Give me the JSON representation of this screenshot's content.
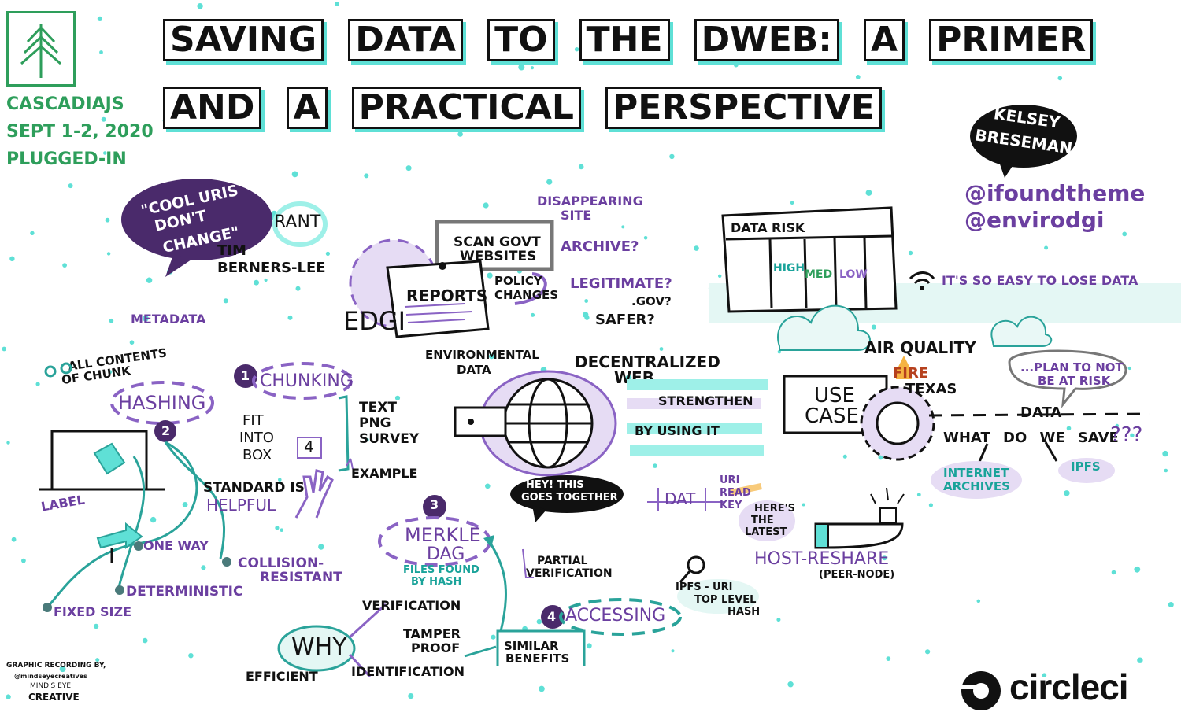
{
  "event": {
    "name": "CASCADIAJS",
    "dates": "SEPT 1-2, 2020",
    "format": "PLUGGED-IN",
    "logo_icon": "pine-tree-icon",
    "color": "#2e9e5b"
  },
  "title": {
    "line1": [
      "SAVING",
      "DATA",
      "TO",
      "THE",
      "DWEB:",
      "A",
      "PRIMER"
    ],
    "line2": [
      "AND",
      "A",
      "PRACTICAL",
      "PERSPECTIVE"
    ]
  },
  "speaker": {
    "name_line1": "KELSEY",
    "name_line2": "BRESEMAN",
    "handle1": "@ifoundtheme",
    "handle2": "@envirodgi"
  },
  "quote": {
    "line1": "\"COOL URIS",
    "line2": "DON'T",
    "line3": "CHANGE\"",
    "author_line1": "TIM",
    "author_line2": "BERNERS-LEE",
    "aside": "RANT"
  },
  "edgi": {
    "name": "EDGI",
    "reports": "REPORTS",
    "scan_line1": "SCAN GOVT",
    "scan_line2": "WEBSITES",
    "disappearing_line1": "DISAPPEARING",
    "disappearing_line2": "SITE",
    "archive": "ARCHIVE?",
    "policy_line1": "POLICY",
    "policy_line2": "CHANGES",
    "legitimate": "LEGITIMATE?",
    "gov": ".GOV?",
    "safer": "SAFER?",
    "env_line1": "ENVIRONMENTAL",
    "env_line2": "DATA"
  },
  "risk": {
    "title": "DATA RISK",
    "levels": [
      "HIGH",
      "MED",
      "LOW"
    ],
    "note": "IT'S SO EASY TO LOSE DATA"
  },
  "hashing": {
    "metadata": "METADATA",
    "contents_line1": "ALL CONTENTS",
    "contents_line2": "OF CHUNK",
    "label": "HASHING",
    "step": "2",
    "tag_label": "LABEL",
    "one_way": "ONE WAY",
    "deterministic": "DETERMINISTIC",
    "fixed_size": "FIXED SIZE",
    "collision_line1": "COLLISION-",
    "collision_line2": "RESISTANT",
    "standard_line1": "STANDARD IS",
    "standard_line2": "HELPFUL"
  },
  "chunking": {
    "step": "1",
    "label": "CHUNKING",
    "fit": "FIT",
    "into": "INTO",
    "box": "BOX",
    "box_count": "4",
    "types": [
      "TEXT",
      "PNG",
      "SURVEY"
    ],
    "example": "EXAMPLE"
  },
  "dweb": {
    "title_line1": "DECENTRALIZED",
    "title_line2": "WEB",
    "strengthen": "STRENGTHEN",
    "by_using": "BY USING IT",
    "hey_line1": "HEY! THIS",
    "hey_line2": "GOES TOGETHER"
  },
  "merkle": {
    "step": "3",
    "line1": "MERKLE",
    "line2": "DAG",
    "files_line1": "FILES FOUND",
    "files_line2": "BY HASH",
    "partial_line1": "PARTIAL",
    "partial_line2": "VERIFICATION"
  },
  "accessing": {
    "step": "4",
    "label": "ACCESSING",
    "similar_line1": "SIMILAR",
    "similar_line2": "BENEFITS",
    "why": "WHY",
    "verification": "VERIFICATION",
    "tamper_line1": "TAMPER",
    "tamper_line2": "PROOF",
    "identification": "IDENTIFICATION",
    "efficient": "EFFICIENT",
    "ipfs_line1": "IPFS - URI",
    "ipfs_line2": "TOP LEVEL",
    "ipfs_line3": "HASH"
  },
  "dat": {
    "label": "DAT",
    "uri": "URI",
    "read": "READ",
    "key": "KEY",
    "latest_line1": "HERE'S",
    "latest_line2": "THE",
    "latest_line3": "LATEST",
    "host_reshare": "HOST-RESHARE",
    "peer_node": "(PEER-NODE)"
  },
  "use_case": {
    "line1": "USE",
    "line2": "CASE",
    "air_quality": "AIR QUALITY",
    "fire": "FIRE",
    "texas": "TEXAS",
    "plan_line1": "...PLAN TO NOT",
    "plan_line2": "BE AT RISK",
    "data": "DATA",
    "what_do_we_save": "WHAT DO WE SAVE",
    "question_marks": "???",
    "internet_line1": "INTERNET",
    "internet_line2": "ARCHIVES",
    "ipfs": "IPFS"
  },
  "credit": {
    "line1": "GRAPHIC RECORDING BY,",
    "line2": "@mindseyecreatives",
    "line3": "MIND'S EYE",
    "line4": "CREATIVE"
  },
  "sponsor": {
    "name": "circleci",
    "icon": "circleci-logo-icon"
  }
}
